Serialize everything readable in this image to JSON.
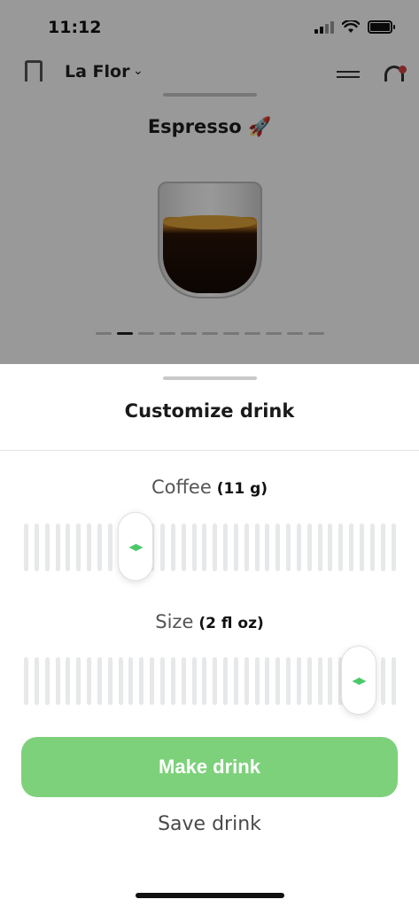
{
  "status_bar": {
    "time": "11:12"
  },
  "background": {
    "machine_name": "La Flor",
    "chevron": "⌄",
    "drink_title": "Espresso 🚀",
    "pager": {
      "pages": 11,
      "active_index": 1
    }
  },
  "sheet": {
    "title": "Customize drink",
    "coffee": {
      "label": "Coffee",
      "value": "(11 g)",
      "position_fraction": 0.3
    },
    "size": {
      "label": "Size",
      "value": "(2 fl oz)",
      "position_fraction": 0.9
    },
    "make_button": "Make drink",
    "save_button": "Save drink"
  },
  "colors": {
    "accent_green": "#7dd17b",
    "thumb_arrow_green": "#4cc96b"
  },
  "icons": [
    "machine-icon",
    "chevron-down-icon",
    "settings-icon",
    "notification-icon",
    "signal-icon",
    "wifi-icon",
    "battery-icon",
    "slider-arrows-icon"
  ]
}
